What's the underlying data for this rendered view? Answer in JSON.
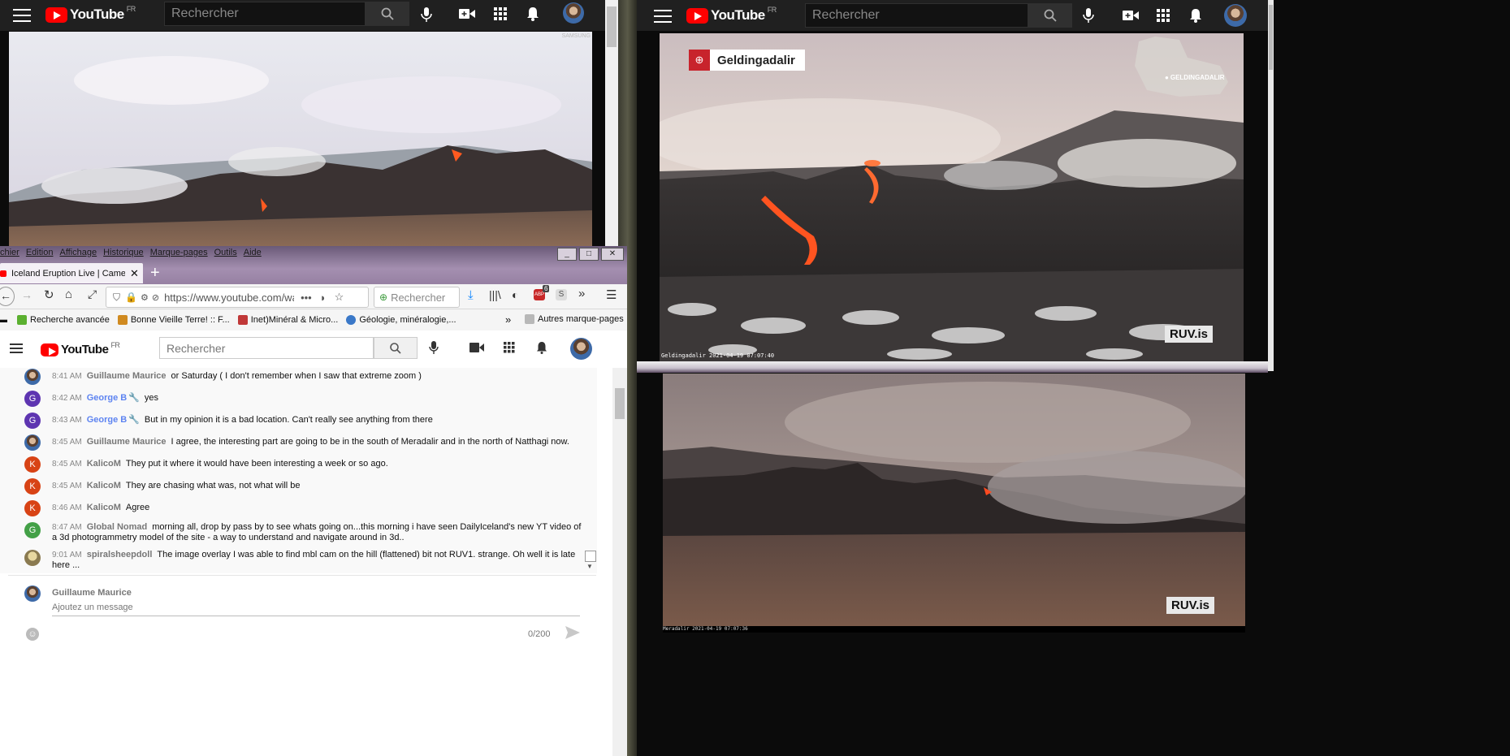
{
  "yt_left": {
    "logo": "YouTube",
    "region": "FR",
    "search_placeholder": "Rechercher",
    "watermark": "SAMSUNG"
  },
  "yt_right": {
    "logo": "YouTube",
    "region": "FR",
    "search_placeholder": "Rechercher",
    "top_video": {
      "channel_badge": "Geldingadalir",
      "map_label": "GELDINGADALIR",
      "brand": "RUV.is",
      "timestamp": "Geldingadalir 2021-04-19 07:07:40"
    },
    "bottom_video": {
      "brand": "RUV.is",
      "timestamp": "Meradalir 2021-04-19 07:07:36"
    }
  },
  "firefox": {
    "menu": [
      "chier",
      "Edition",
      "Affichage",
      "Historique",
      "Marque-pages",
      "Outils",
      "Aide"
    ],
    "window_buttons": [
      "_",
      "□",
      "✕"
    ],
    "tab_title": "Iceland Eruption Live | Camera",
    "url": "https://www.youtube.com/wat",
    "search_placeholder": "Rechercher",
    "abp_badge": "6",
    "bookmarks": [
      {
        "label": "Recherche avancée",
        "color": "#5bb030"
      },
      {
        "label": "Bonne Vieille Terre! :: F...",
        "color": "#d08a20"
      },
      {
        "label": "Inet)Minéral & Micro...",
        "color": "#c03838"
      },
      {
        "label": "Géologie, minéralogie,...",
        "color": "#3a78c8"
      }
    ],
    "other_bookmarks": "Autres marque-pages"
  },
  "yt_light": {
    "logo": "YouTube",
    "region": "FR",
    "search_placeholder": "Rechercher"
  },
  "chat": {
    "messages": [
      {
        "time": "8:41 AM",
        "author": "Guillaume Maurice",
        "text": "or Saturday ( I don't remember when I saw that extreme zoom )",
        "initial": "",
        "color": "#3d6aa8",
        "mod": false
      },
      {
        "time": "8:42 AM",
        "author": "George B",
        "text": "yes",
        "initial": "G",
        "color": "#5e35b1",
        "mod": true
      },
      {
        "time": "8:43 AM",
        "author": "George B",
        "text": "But in my opinion it is a bad location. Can't really see anything from there",
        "initial": "G",
        "color": "#5e35b1",
        "mod": true
      },
      {
        "time": "8:45 AM",
        "author": "Guillaume Maurice",
        "text": "I agree, the interesting part are going to be in the south of Meradalir and in the north of Natthagi now.",
        "initial": "",
        "color": "#3d6aa8",
        "mod": false
      },
      {
        "time": "8:45 AM",
        "author": "KalicoM",
        "text": "They put it where it would have been interesting a week or so ago.",
        "initial": "K",
        "color": "#d84315",
        "mod": false
      },
      {
        "time": "8:45 AM",
        "author": "KalicoM",
        "text": "They are chasing what was, not what will be",
        "initial": "K",
        "color": "#d84315",
        "mod": false
      },
      {
        "time": "8:46 AM",
        "author": "KalicoM",
        "text": "Agree",
        "initial": "K",
        "color": "#d84315",
        "mod": false
      },
      {
        "time": "8:47 AM",
        "author": "Global Nomad",
        "text": "morning all, drop by pass by to see whats going on...this morning i have seen DailyIceland's new YT video of a 3d photogrammetry model of the site - a way to understand and navigate around in 3d..",
        "initial": "G",
        "color": "#43a047",
        "mod": false
      },
      {
        "time": "9:01 AM",
        "author": "spiralsheepdoll",
        "text": "The image overlay I was able to find mbl cam on the hill (flattened) bit not RUV1. strange. Oh well it is late here ...",
        "initial": "",
        "color": "#8a7a50",
        "mod": false
      }
    ],
    "composer": {
      "author": "Guillaume Maurice",
      "placeholder": "Ajoutez un message",
      "counter": "0/200"
    }
  }
}
